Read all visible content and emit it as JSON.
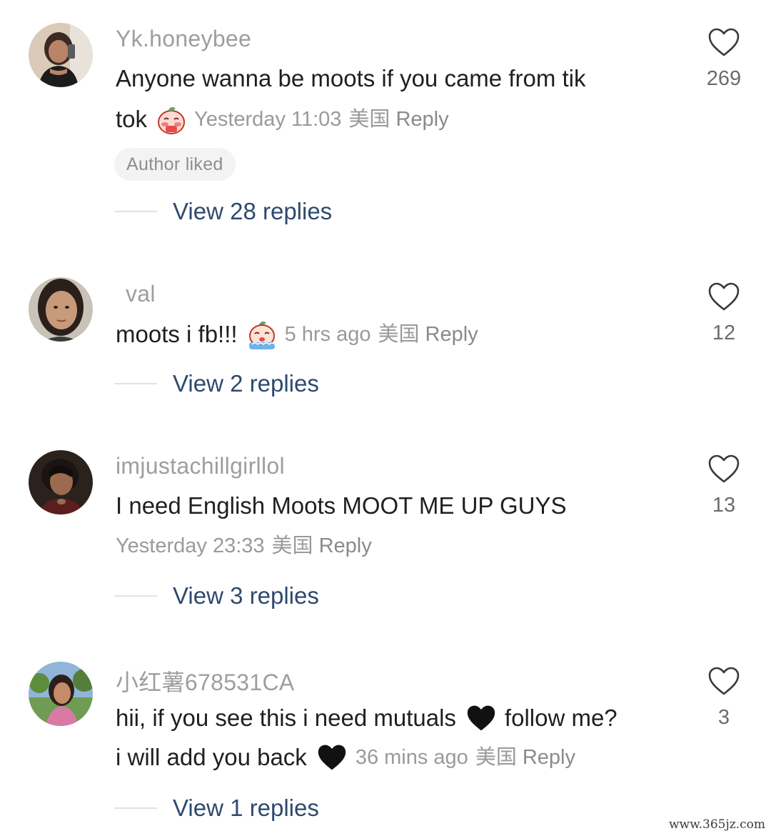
{
  "comments": [
    {
      "username": "Yk.honeybee",
      "text_line1": "Anyone wanna be moots if you came from tik",
      "text_line2": "tok",
      "emoji": "shy-blushing-face-emoji",
      "time": "Yesterday 11:03",
      "location": "美国",
      "reply_label": "Reply",
      "badge": "Author liked",
      "view_replies": "View 28 replies",
      "likes": "269"
    },
    {
      "username": "val",
      "text_line1": "moots i fb!!!",
      "emoji": "crying-face-emoji",
      "time": "5 hrs ago",
      "location": "美国",
      "reply_label": "Reply",
      "view_replies": "View 2 replies",
      "likes": "12"
    },
    {
      "username": "imjustachillgirllol",
      "text_line1": "I need English Moots MOOT ME UP GUYS",
      "time": "Yesterday 23:33",
      "location": "美国",
      "reply_label": "Reply",
      "view_replies": "View 3 replies",
      "likes": "13"
    },
    {
      "username": "小红薯678531CA",
      "text_line1a": "hii, if you see this i need mutuals",
      "text_line1b": "follow me?",
      "text_line2": "i will add you back",
      "emoji": "black-heart-emoji",
      "time": "36 mins ago",
      "location": "美国",
      "reply_label": "Reply",
      "view_replies": "View 1 replies",
      "likes": "3"
    }
  ],
  "watermark": "www.365jz.com",
  "icons": {
    "like": "heart-outline-icon"
  },
  "colors": {
    "link": "#2d4a6e",
    "meta": "#9a9a9a",
    "text": "#1f1f1f"
  }
}
